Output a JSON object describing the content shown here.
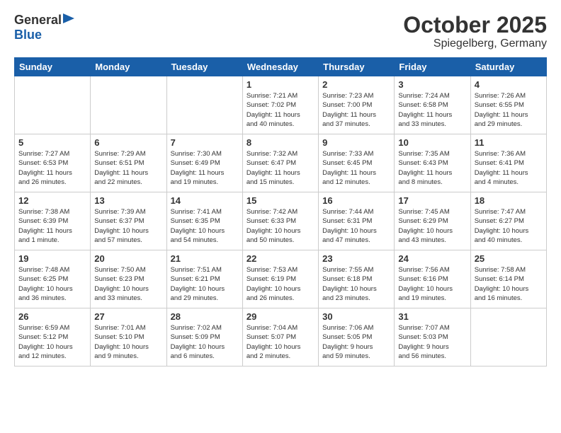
{
  "header": {
    "logo": {
      "general": "General",
      "blue": "Blue"
    },
    "month": "October 2025",
    "location": "Spiegelberg, Germany"
  },
  "weekdays": [
    "Sunday",
    "Monday",
    "Tuesday",
    "Wednesday",
    "Thursday",
    "Friday",
    "Saturday"
  ],
  "weeks": [
    [
      {
        "day": "",
        "info": "",
        "empty": true
      },
      {
        "day": "",
        "info": "",
        "empty": true
      },
      {
        "day": "",
        "info": "",
        "empty": true
      },
      {
        "day": "1",
        "info": "Sunrise: 7:21 AM\nSunset: 7:02 PM\nDaylight: 11 hours\nand 40 minutes."
      },
      {
        "day": "2",
        "info": "Sunrise: 7:23 AM\nSunset: 7:00 PM\nDaylight: 11 hours\nand 37 minutes."
      },
      {
        "day": "3",
        "info": "Sunrise: 7:24 AM\nSunset: 6:58 PM\nDaylight: 11 hours\nand 33 minutes."
      },
      {
        "day": "4",
        "info": "Sunrise: 7:26 AM\nSunset: 6:55 PM\nDaylight: 11 hours\nand 29 minutes."
      }
    ],
    [
      {
        "day": "5",
        "info": "Sunrise: 7:27 AM\nSunset: 6:53 PM\nDaylight: 11 hours\nand 26 minutes."
      },
      {
        "day": "6",
        "info": "Sunrise: 7:29 AM\nSunset: 6:51 PM\nDaylight: 11 hours\nand 22 minutes."
      },
      {
        "day": "7",
        "info": "Sunrise: 7:30 AM\nSunset: 6:49 PM\nDaylight: 11 hours\nand 19 minutes."
      },
      {
        "day": "8",
        "info": "Sunrise: 7:32 AM\nSunset: 6:47 PM\nDaylight: 11 hours\nand 15 minutes."
      },
      {
        "day": "9",
        "info": "Sunrise: 7:33 AM\nSunset: 6:45 PM\nDaylight: 11 hours\nand 12 minutes."
      },
      {
        "day": "10",
        "info": "Sunrise: 7:35 AM\nSunset: 6:43 PM\nDaylight: 11 hours\nand 8 minutes."
      },
      {
        "day": "11",
        "info": "Sunrise: 7:36 AM\nSunset: 6:41 PM\nDaylight: 11 hours\nand 4 minutes."
      }
    ],
    [
      {
        "day": "12",
        "info": "Sunrise: 7:38 AM\nSunset: 6:39 PM\nDaylight: 11 hours\nand 1 minute."
      },
      {
        "day": "13",
        "info": "Sunrise: 7:39 AM\nSunset: 6:37 PM\nDaylight: 10 hours\nand 57 minutes."
      },
      {
        "day": "14",
        "info": "Sunrise: 7:41 AM\nSunset: 6:35 PM\nDaylight: 10 hours\nand 54 minutes."
      },
      {
        "day": "15",
        "info": "Sunrise: 7:42 AM\nSunset: 6:33 PM\nDaylight: 10 hours\nand 50 minutes."
      },
      {
        "day": "16",
        "info": "Sunrise: 7:44 AM\nSunset: 6:31 PM\nDaylight: 10 hours\nand 47 minutes."
      },
      {
        "day": "17",
        "info": "Sunrise: 7:45 AM\nSunset: 6:29 PM\nDaylight: 10 hours\nand 43 minutes."
      },
      {
        "day": "18",
        "info": "Sunrise: 7:47 AM\nSunset: 6:27 PM\nDaylight: 10 hours\nand 40 minutes."
      }
    ],
    [
      {
        "day": "19",
        "info": "Sunrise: 7:48 AM\nSunset: 6:25 PM\nDaylight: 10 hours\nand 36 minutes."
      },
      {
        "day": "20",
        "info": "Sunrise: 7:50 AM\nSunset: 6:23 PM\nDaylight: 10 hours\nand 33 minutes."
      },
      {
        "day": "21",
        "info": "Sunrise: 7:51 AM\nSunset: 6:21 PM\nDaylight: 10 hours\nand 29 minutes."
      },
      {
        "day": "22",
        "info": "Sunrise: 7:53 AM\nSunset: 6:19 PM\nDaylight: 10 hours\nand 26 minutes."
      },
      {
        "day": "23",
        "info": "Sunrise: 7:55 AM\nSunset: 6:18 PM\nDaylight: 10 hours\nand 23 minutes."
      },
      {
        "day": "24",
        "info": "Sunrise: 7:56 AM\nSunset: 6:16 PM\nDaylight: 10 hours\nand 19 minutes."
      },
      {
        "day": "25",
        "info": "Sunrise: 7:58 AM\nSunset: 6:14 PM\nDaylight: 10 hours\nand 16 minutes."
      }
    ],
    [
      {
        "day": "26",
        "info": "Sunrise: 6:59 AM\nSunset: 5:12 PM\nDaylight: 10 hours\nand 12 minutes."
      },
      {
        "day": "27",
        "info": "Sunrise: 7:01 AM\nSunset: 5:10 PM\nDaylight: 10 hours\nand 9 minutes."
      },
      {
        "day": "28",
        "info": "Sunrise: 7:02 AM\nSunset: 5:09 PM\nDaylight: 10 hours\nand 6 minutes."
      },
      {
        "day": "29",
        "info": "Sunrise: 7:04 AM\nSunset: 5:07 PM\nDaylight: 10 hours\nand 2 minutes."
      },
      {
        "day": "30",
        "info": "Sunrise: 7:06 AM\nSunset: 5:05 PM\nDaylight: 9 hours\nand 59 minutes."
      },
      {
        "day": "31",
        "info": "Sunrise: 7:07 AM\nSunset: 5:03 PM\nDaylight: 9 hours\nand 56 minutes."
      },
      {
        "day": "",
        "info": "",
        "empty": true
      }
    ]
  ]
}
